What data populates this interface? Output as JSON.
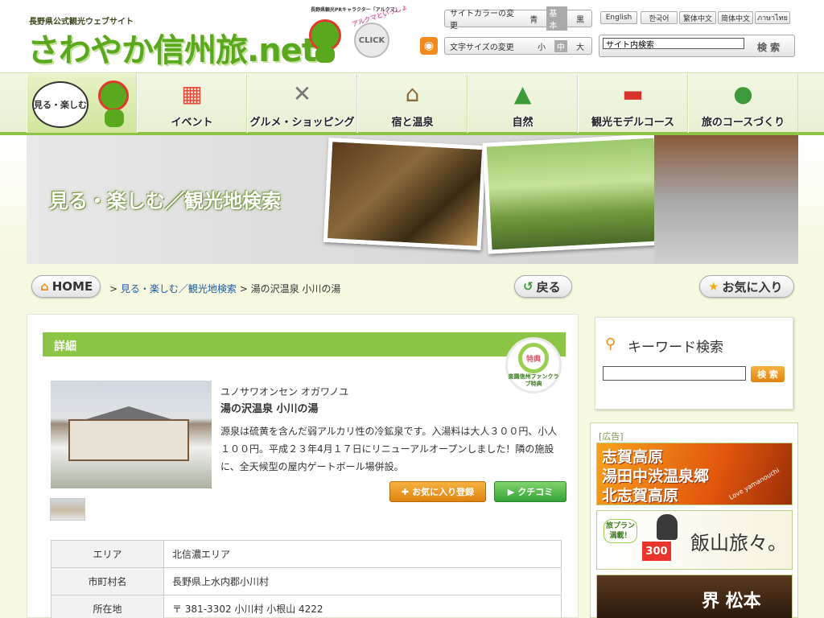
{
  "header": {
    "site_tag": "長野県公式観光ウェブサイト",
    "logo": "さわやか信州旅.net",
    "chara_tag": "長野県観光PRキャラクター「アルクマ」",
    "click_top": "アルクマといっしょ",
    "click_label": "CLICK",
    "color_ctl": {
      "label": "サイトカラーの変更",
      "options": [
        "青",
        "基本",
        "黒"
      ],
      "selected": "基本"
    },
    "font_ctl": {
      "label": "文字サイズの変更",
      "options": [
        "小",
        "中",
        "大"
      ],
      "selected": "中"
    },
    "languages": [
      "English",
      "한국어",
      "繁体中文",
      "简体中文",
      "ภาษาไทย"
    ],
    "search_placeholder": "サイト内検索",
    "search_button": "検 索"
  },
  "nav": {
    "items": [
      "見る・楽しむ",
      "イベント",
      "グルメ・ショッピング",
      "宿と温泉",
      "自然",
      "観光モデルコース",
      "旅のコースづくり"
    ]
  },
  "hero": {
    "title": "見る・楽しむ／観光地検索"
  },
  "breadcrumb": {
    "home": "HOME",
    "link": "見る・楽しむ／観光地検索",
    "current": "湯の沢温泉 小川の湯",
    "back": "戻る",
    "favorite": "お気に入り"
  },
  "detail": {
    "section_title": "詳細",
    "badge_top": "特典",
    "badge_bottom": "楽園信州ファンクラブ特典",
    "kana": "ユノサワオンセン オガワノユ",
    "name": "湯の沢温泉 小川の湯",
    "description": "源泉は硫黄を含んだ弱アルカリ性の冷鉱泉です。入湯料は大人３００円、小人１００円。平成２３年4月１７日にリニューアルオープンしました！隣の施設に、全天候型の屋内ゲートボール場併設。",
    "fav_button": "お気に入り登録",
    "review_button": "クチコミ",
    "table": [
      {
        "key": "エリア",
        "value": "北信濃エリア"
      },
      {
        "key": "市町村名",
        "value": "長野県上水内郡小川村"
      },
      {
        "key": "所在地",
        "value": "〒 381-3302 小川村 小根山 4222"
      }
    ]
  },
  "sidebar": {
    "keyword_title": "キーワード検索",
    "keyword_button": "検 索",
    "ad_label": "[広告]",
    "ad1_lines": [
      "志賀高原",
      "湯田中渋温泉郷",
      "北志賀高原"
    ],
    "ad1_sub": "Love yamanouchi",
    "ad2_title": "飯山旅々。",
    "ad2_bubble": "旅プラン満載！",
    "ad2_count": "300",
    "ad3_title": "界 松本"
  }
}
